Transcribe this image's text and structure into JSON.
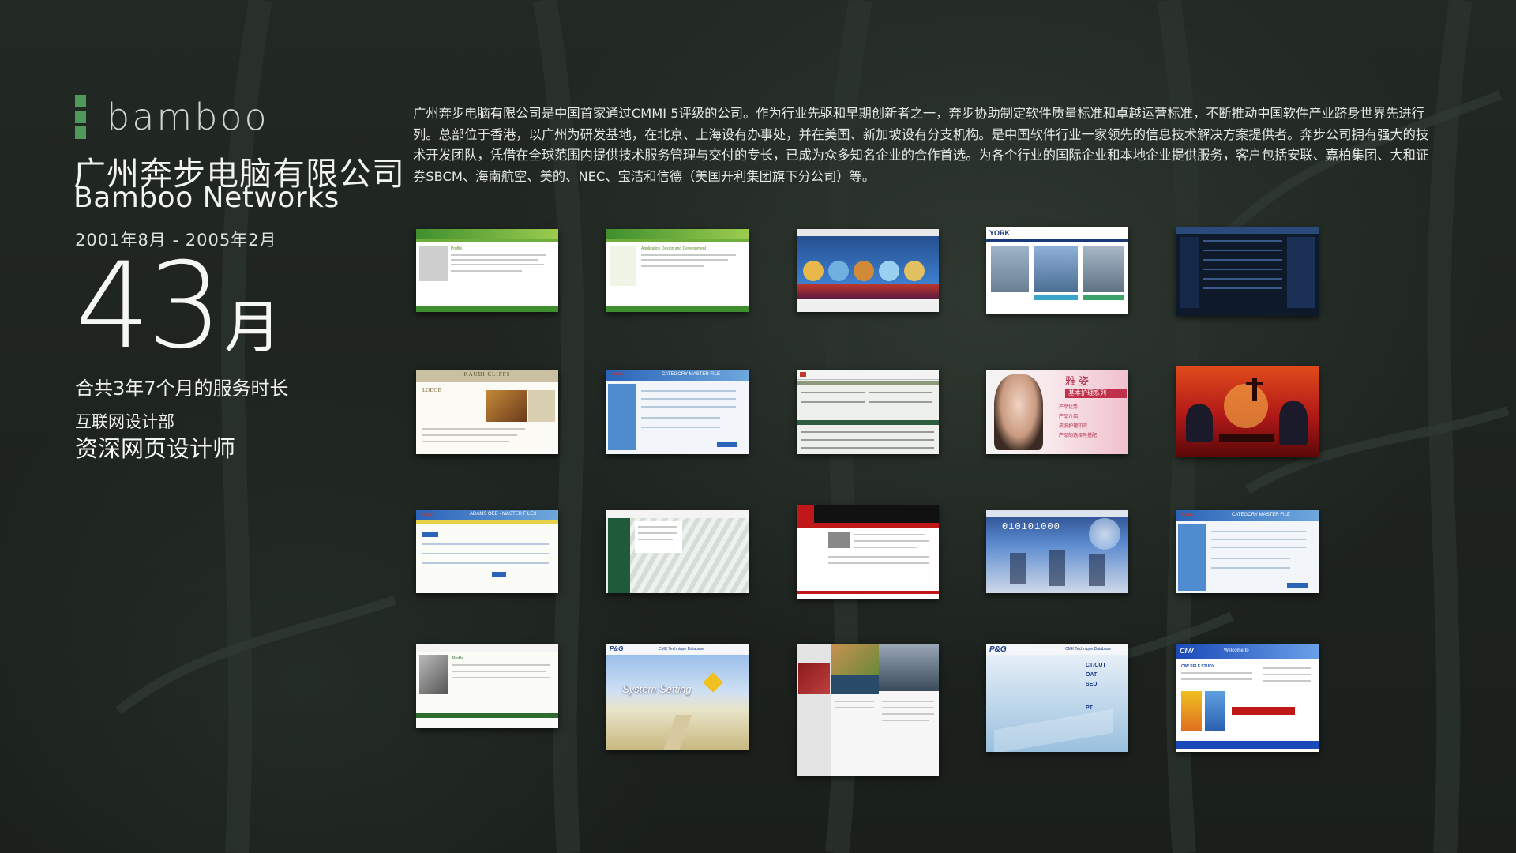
{
  "logo": {
    "text": "bamboo"
  },
  "company": {
    "name_cn": "广州奔步电脑有限公司",
    "name_en": "Bamboo Networks"
  },
  "period": "2001年8月 - 2005年2月",
  "duration": {
    "number": "43",
    "unit": "月"
  },
  "service_text": "合共3年7个月的服务时长",
  "department": "互联网设计部",
  "job_title": "资深网页设计师",
  "description": "广州奔步电脑有限公司是中国首家通过CMMI 5评级的公司。作为行业先驱和早期创新者之一，奔步协助制定软件质量标准和卓越运营标准，不断推动中国软件产业跻身世界先进行列。总部位于香港，以广州为研发基地，在北京、上海设有办事处，并在美国、新加坡设有分支机构。是中国软件行业一家领先的信息技术解决方案提供者。奔步公司拥有强大的技术开发团队，凭借在全球范围内提供技术服务管理与交付的专长，已成为众多知名企业的合作首选。为各个行业的国际企业和本地企业提供服务，客户包括安联、嘉柏集团、大和证券SBCM、海南航空、美的、NEC、宝洁和信德（美国开利集团旗下分公司）等。",
  "thumbnails": {
    "t1": {
      "heading": "Profile"
    },
    "t2": {
      "heading": "Application Design and Development"
    },
    "t4": {
      "brand": "YORK"
    },
    "t6": {
      "header": "KAUBI CLIFFS",
      "heading": "LODGE"
    },
    "t7": {
      "brand": "Asia",
      "header": "CATEGORY MASTER FILE"
    },
    "t9": {
      "brand": "雅 姿",
      "headline": "基本护理系列",
      "items": [
        "产品优势",
        "产品介绍",
        "皮肤护理知识",
        "产品的选择与搭配"
      ]
    },
    "t11": {
      "brand": "Asia",
      "header": "ADAMS OEE - MASTER FILES"
    },
    "t15": {
      "banner": "010101000"
    },
    "t16": {
      "brand": "Asia",
      "header": "CATEGORY MASTER FILE"
    },
    "t17": {
      "heading": "Profile"
    },
    "t18": {
      "brand": "P&G",
      "header": "CMK Technique Database",
      "headline": "System Setting"
    },
    "t20": {
      "brand": "P&G",
      "header": "CMK Technique Database",
      "menu": [
        "CT/CUT",
        "OAT",
        "SED",
        "PT"
      ]
    },
    "t21": {
      "brand": "CIW",
      "header": "Welcome to",
      "section": "CIW SELF STUDY"
    }
  }
}
